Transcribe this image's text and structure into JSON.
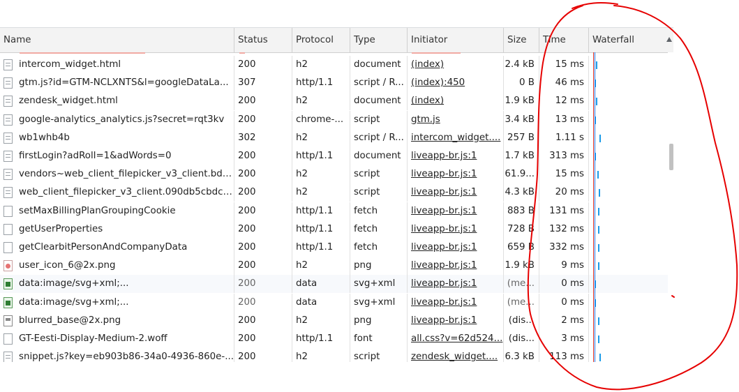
{
  "columns": [
    "Name",
    "Status",
    "Protocol",
    "Type",
    "Initiator",
    "Size",
    "Time",
    "Waterfall"
  ],
  "rows": [
    {
      "icon": "document-icon",
      "name": "intercom_widget.html",
      "status": "200",
      "protocol": "h2",
      "type": "document",
      "initiator": "(index)",
      "size": "2.4 kB",
      "time": "15 ms",
      "dim": false,
      "alt": false
    },
    {
      "icon": "document-icon",
      "name": "gtm.js?id=GTM-NCLXNTS&l=googleDataLa...",
      "status": "307",
      "protocol": "http/1.1",
      "type": "script / R...",
      "initiator": "(index):450",
      "size": "0 B",
      "time": "46 ms",
      "dim": false,
      "alt": false
    },
    {
      "icon": "document-icon",
      "name": "zendesk_widget.html",
      "status": "200",
      "protocol": "h2",
      "type": "document",
      "initiator": "(index)",
      "size": "1.9 kB",
      "time": "12 ms",
      "dim": false,
      "alt": false
    },
    {
      "icon": "document-icon",
      "name": "google-analytics_analytics.js?secret=rqt3kv",
      "status": "200",
      "protocol": "chrome-...",
      "type": "script",
      "initiator": "gtm.js",
      "size": "3.4 kB",
      "time": "13 ms",
      "dim": false,
      "alt": false
    },
    {
      "icon": "document-icon",
      "name": "wb1whb4b",
      "status": "302",
      "protocol": "h2",
      "type": "script / R...",
      "initiator": "intercom_widget....",
      "size": "257 B",
      "time": "1.11 s",
      "dim": false,
      "alt": false
    },
    {
      "icon": "document-icon",
      "name": "firstLogin?adRoll=1&adWords=0",
      "status": "200",
      "protocol": "http/1.1",
      "type": "document",
      "initiator": "liveapp-br.js:1",
      "size": "1.7 kB",
      "time": "313 ms",
      "dim": false,
      "alt": false
    },
    {
      "icon": "document-icon",
      "name": "vendors~web_client_filepicker_v3_client.bd5...",
      "status": "200",
      "protocol": "h2",
      "type": "script",
      "initiator": "liveapp-br.js:1",
      "size": "61.9...",
      "time": "15 ms",
      "dim": false,
      "alt": false
    },
    {
      "icon": "document-icon",
      "name": "web_client_filepicker_v3_client.090db5cbdc7...",
      "status": "200",
      "protocol": "h2",
      "type": "script",
      "initiator": "liveapp-br.js:1",
      "size": "4.3 kB",
      "time": "20 ms",
      "dim": false,
      "alt": false
    },
    {
      "icon": "blank-file-icon",
      "name": "setMaxBillingPlanGroupingCookie",
      "status": "200",
      "protocol": "http/1.1",
      "type": "fetch",
      "initiator": "liveapp-br.js:1",
      "size": "883 B",
      "time": "131 ms",
      "dim": false,
      "alt": false
    },
    {
      "icon": "blank-file-icon",
      "name": "getUserProperties",
      "status": "200",
      "protocol": "http/1.1",
      "type": "fetch",
      "initiator": "liveapp-br.js:1",
      "size": "728 B",
      "time": "132 ms",
      "dim": false,
      "alt": false
    },
    {
      "icon": "blank-file-icon",
      "name": "getClearbitPersonAndCompanyData",
      "status": "200",
      "protocol": "http/1.1",
      "type": "fetch",
      "initiator": "liveapp-br.js:1",
      "size": "659 B",
      "time": "332 ms",
      "dim": false,
      "alt": false
    },
    {
      "icon": "user-image-icon",
      "name": "user_icon_6@2x.png",
      "status": "200",
      "protocol": "h2",
      "type": "png",
      "initiator": "liveapp-br.js:1",
      "size": "1.9 kB",
      "time": "9 ms",
      "dim": false,
      "alt": false
    },
    {
      "icon": "svg-image-icon",
      "name": "data:image/svg+xml;...",
      "status": "200",
      "protocol": "data",
      "type": "svg+xml",
      "initiator": "liveapp-br.js:1",
      "size": "(me...",
      "time": "0 ms",
      "dim": true,
      "alt": true
    },
    {
      "icon": "svg-image-icon",
      "name": "data:image/svg+xml;...",
      "status": "200",
      "protocol": "data",
      "type": "svg+xml",
      "initiator": "liveapp-br.js:1",
      "size": "(me...",
      "time": "0 ms",
      "dim": true,
      "alt": false
    },
    {
      "icon": "image-icon",
      "name": "blurred_base@2x.png",
      "status": "200",
      "protocol": "h2",
      "type": "png",
      "initiator": "liveapp-br.js:1",
      "size": "(dis...",
      "time": "2 ms",
      "dim": false,
      "alt": false
    },
    {
      "icon": "blank-file-icon",
      "name": "GT-Eesti-Display-Medium-2.woff",
      "status": "200",
      "protocol": "http/1.1",
      "type": "font",
      "initiator": "all.css?v=62d524...",
      "size": "(dis...",
      "time": "3 ms",
      "dim": false,
      "alt": false
    },
    {
      "icon": "document-icon",
      "name": "snippet.js?key=eb903b86-34a0-4936-860e-...",
      "status": "200",
      "protocol": "h2",
      "type": "script",
      "initiator": "zendesk_widget....",
      "size": "6.3 kB",
      "time": "113 ms",
      "dim": false,
      "alt": false
    }
  ],
  "waterfall_offsets": [
    2,
    0,
    2,
    0,
    7,
    0,
    4,
    6,
    5,
    5,
    5,
    5,
    0,
    0,
    5,
    5,
    7
  ],
  "colors": {
    "annotation": "#e60000",
    "waterfall": "#1a9be8",
    "marker_red": "#d93025",
    "marker_blue": "#1a73e8"
  }
}
